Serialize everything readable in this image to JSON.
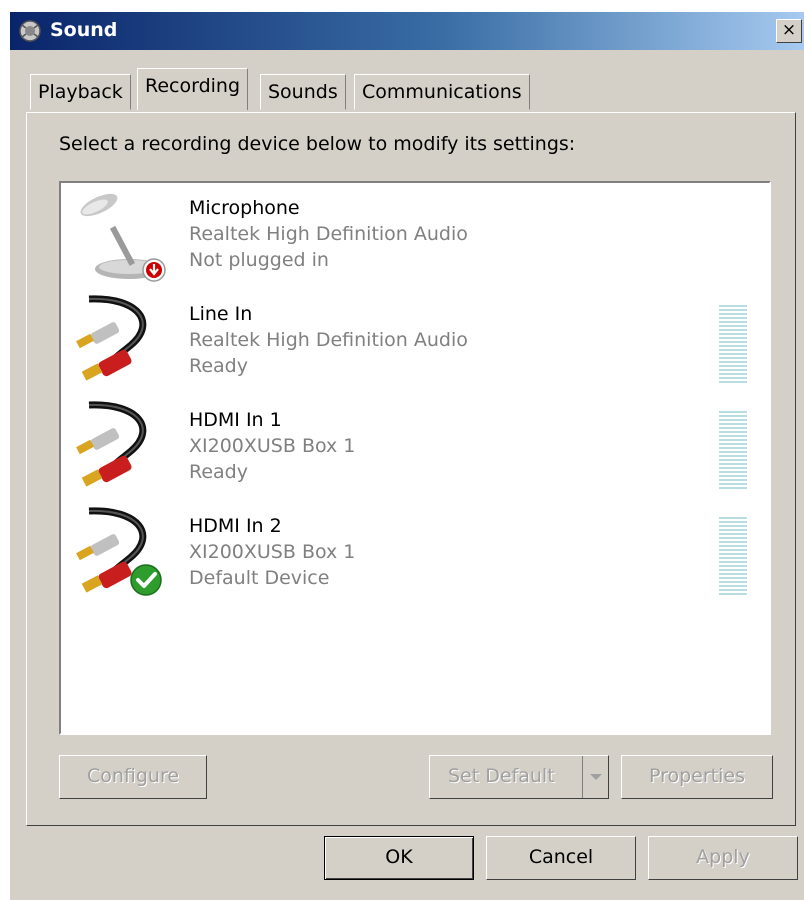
{
  "window": {
    "title": "Sound",
    "close_glyph": "×"
  },
  "tabs": [
    {
      "label": "Playback",
      "active": false
    },
    {
      "label": "Recording",
      "active": true
    },
    {
      "label": "Sounds",
      "active": false
    },
    {
      "label": "Communications",
      "active": false
    }
  ],
  "panel": {
    "instruction": "Select a recording device below to modify its settings:",
    "devices": [
      {
        "name": "Microphone",
        "description": "Realtek High Definition Audio",
        "status": "Not plugged in",
        "icon": "microphone-icon",
        "badge": "unplugged-badge-icon",
        "show_meter": false
      },
      {
        "name": "Line In",
        "description": "Realtek High Definition Audio",
        "status": "Ready",
        "icon": "rca-cable-icon",
        "badge": "",
        "show_meter": true
      },
      {
        "name": "HDMI In 1",
        "description": "XI200XUSB Box 1",
        "status": "Ready",
        "icon": "rca-cable-icon",
        "badge": "",
        "show_meter": true
      },
      {
        "name": "HDMI In 2",
        "description": "XI200XUSB Box 1",
        "status": "Default Device",
        "icon": "rca-cable-icon",
        "badge": "default-check-icon",
        "show_meter": true
      }
    ],
    "buttons": {
      "configure": "Configure",
      "set_default": "Set Default",
      "properties": "Properties"
    }
  },
  "footer": {
    "ok": "OK",
    "cancel": "Cancel",
    "apply": "Apply"
  },
  "colors": {
    "meter": "#b8dde0",
    "title_gradient_start": "#0a246a",
    "title_gradient_end": "#a6caf0",
    "window_bg": "#d4d0c8"
  }
}
